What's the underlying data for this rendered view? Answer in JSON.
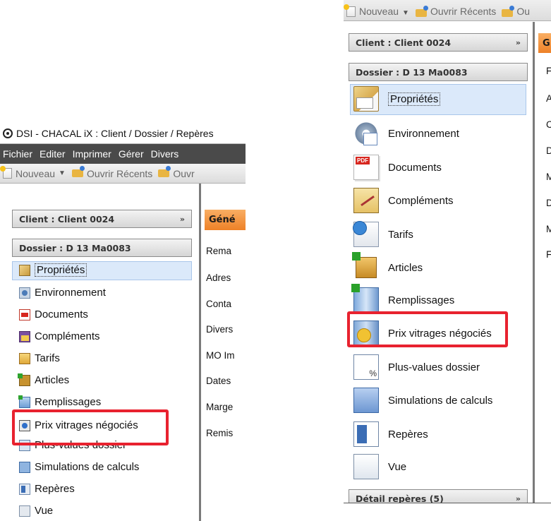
{
  "left": {
    "title": "DSI - CHACAL iX : Client / Dossier / Repères",
    "menu": [
      "Fichier",
      "Editer",
      "Imprimer",
      "Gérer",
      "Divers"
    ],
    "toolbar": {
      "new_label": "Nouveau",
      "recent_label": "Ouvrir Récents",
      "open_label": "Ouvr"
    },
    "client_header": "Client : Client 0024",
    "dossier_header": "Dossier : D 13 Ma0083",
    "nav": [
      "Propriétés",
      "Environnement",
      "Documents",
      "Compléments",
      "Tarifs",
      "Articles",
      "Remplissages",
      "Prix vitrages négociés",
      "Plus-values dossier",
      "Simulations de calculs",
      "Repères",
      "Vue"
    ],
    "active_tab": "Géné",
    "sections": [
      "Rema",
      "Adres",
      "Conta",
      "Divers",
      "MO Im",
      "Dates",
      "Marge",
      "Remis"
    ]
  },
  "right": {
    "toolbar": {
      "new_label": "Nouveau",
      "recent_label": "Ouvrir Récents",
      "open_label": "Ou"
    },
    "client_header": "Client : Client 0024",
    "dossier_header": "Dossier : D 13 Ma0083",
    "nav": [
      "Propriétés",
      "Environnement",
      "Documents",
      "Compléments",
      "Tarifs",
      "Articles",
      "Remplissages",
      "Prix vitrages négociés",
      "Plus-values dossier",
      "Simulations de calculs",
      "Repères",
      "Vue"
    ],
    "detail_header": "Détail repères (5)",
    "active_tab": "G",
    "sections": [
      "F",
      "A",
      "C",
      "D",
      "M",
      "D",
      "M",
      "F"
    ]
  },
  "colors": {
    "highlight": "#e8222f",
    "tab_active": "#ee8127",
    "selection": "#dbe9fa",
    "menubar": "#4a4a4a"
  },
  "chevron": "»"
}
